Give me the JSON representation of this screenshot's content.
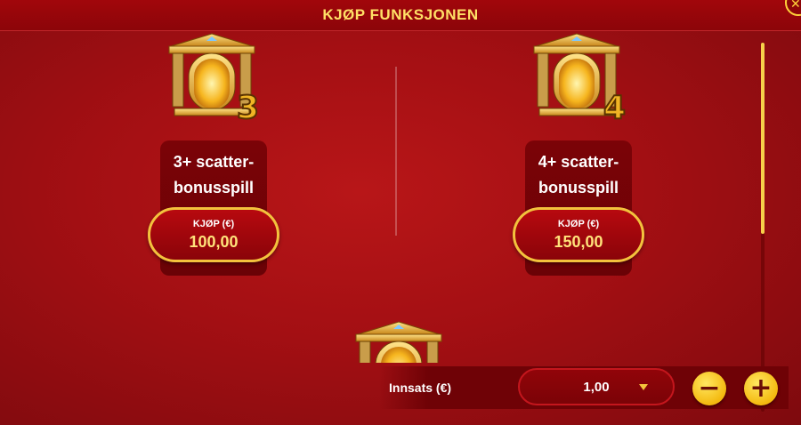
{
  "header": {
    "title": "KJØP FUNKSJONEN"
  },
  "close": {
    "icon": "close-icon",
    "glyph": "✕"
  },
  "offers": [
    {
      "title_line1": "3+ scatter-",
      "title_line2": "bonusspill",
      "buy_label": "KJØP (€)",
      "price": "100,00",
      "badge": "3"
    },
    {
      "title_line1": "4+ scatter-",
      "title_line2": "bonusspill",
      "buy_label": "KJØP (€)",
      "price": "150,00",
      "badge": "4"
    }
  ],
  "bet": {
    "label": "Innsats (€)",
    "value": "1,00",
    "minus": "−",
    "plus": "+"
  },
  "colors": {
    "accent": "#f3c23d",
    "background": "#a30f13",
    "panel": "#6f0206"
  }
}
